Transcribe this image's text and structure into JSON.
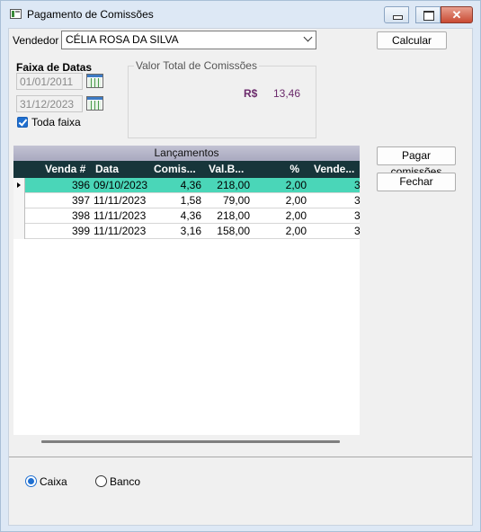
{
  "window": {
    "title": "Pagamento de Comissões",
    "icon": "app-window-icon"
  },
  "vendedor": {
    "label": "Vendedor",
    "value": "CÉLIA ROSA DA SILVA"
  },
  "buttons": {
    "calcular": "Calcular",
    "pagar": "Pagar comissões",
    "fechar": "Fechar"
  },
  "faixa": {
    "label": "Faixa de Datas",
    "start": "01/01/2011",
    "end": "31/12/2023",
    "toda_faixa_label": "Toda faixa",
    "toda_faixa_checked": true
  },
  "valor_total": {
    "label": "Valor Total de Comissões",
    "currency": "R$",
    "amount": "13,46",
    "amount_color": "#6b2a6b"
  },
  "grid": {
    "caption": "Lançamentos",
    "header_color": "#17353a",
    "selected_color": "#4ad6b8",
    "columns": [
      "Venda #",
      "Data",
      "Comis...",
      "Val.B...",
      "%",
      "Vende..."
    ],
    "rows": [
      {
        "venda": "396",
        "data": "09/10/2023",
        "comis": "4,36",
        "valb": "218,00",
        "pct": "2,00",
        "vend": "3",
        "selected": true
      },
      {
        "venda": "397",
        "data": "11/11/2023",
        "comis": "1,58",
        "valb": "79,00",
        "pct": "2,00",
        "vend": "3",
        "selected": false
      },
      {
        "venda": "398",
        "data": "11/11/2023",
        "comis": "4,36",
        "valb": "218,00",
        "pct": "2,00",
        "vend": "3",
        "selected": false
      },
      {
        "venda": "399",
        "data": "11/11/2023",
        "comis": "3,16",
        "valb": "158,00",
        "pct": "2,00",
        "vend": "3",
        "selected": false
      }
    ]
  },
  "payment": {
    "caixa_label": "Caixa",
    "banco_label": "Banco",
    "selected": "Caixa"
  }
}
